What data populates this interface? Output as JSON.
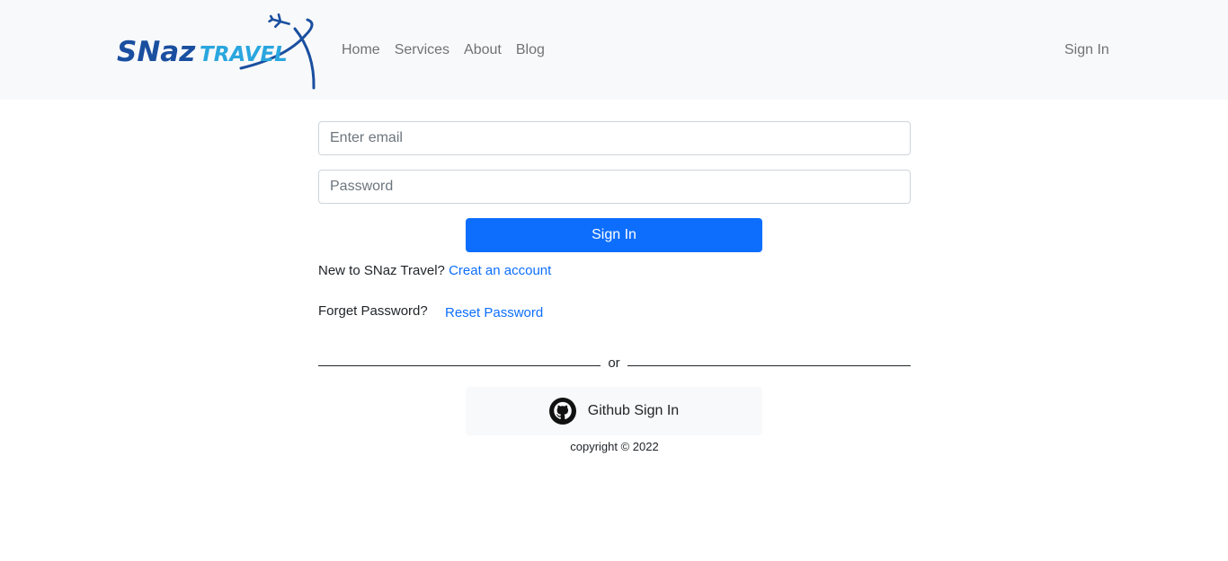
{
  "header": {
    "logo": {
      "text_primary": "SNaz",
      "text_secondary": "TRAVEL",
      "icon": "airplane-icon",
      "colors": {
        "primary": "#1a4fa0",
        "secondary": "#2aa6df"
      }
    },
    "nav": {
      "items": [
        {
          "label": "Home"
        },
        {
          "label": "Services"
        },
        {
          "label": "About"
        },
        {
          "label": "Blog"
        }
      ],
      "signin_label": "Sign In"
    }
  },
  "form": {
    "email": {
      "placeholder": "Enter email",
      "value": ""
    },
    "password": {
      "placeholder": "Password",
      "value": ""
    },
    "submit_label": "Sign In",
    "new_user": {
      "text": "New to SNaz Travel?",
      "link_label": "Creat an account"
    },
    "forget": {
      "text": "Forget Password?",
      "link_label": "Reset Password"
    },
    "divider_text": "or",
    "github": {
      "label": "Github Sign In",
      "icon": "github-icon"
    },
    "copyright": "copyright © 2022"
  },
  "colors": {
    "accent": "#0d6efd",
    "navbar_bg": "#f8f9fa"
  }
}
